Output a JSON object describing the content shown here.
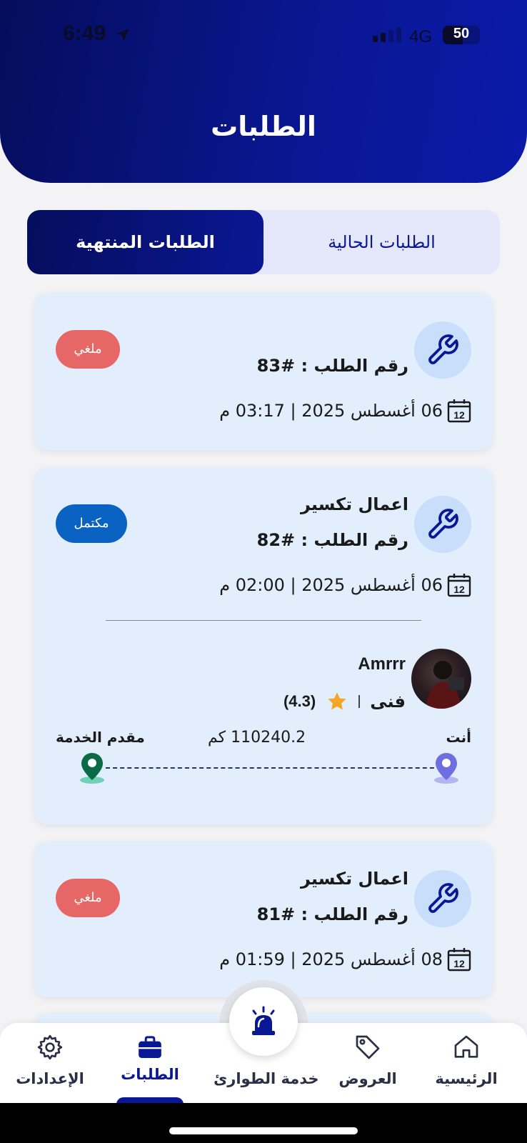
{
  "status_bar": {
    "time": "6:49",
    "network": "4G",
    "battery": "50"
  },
  "header": {
    "title": "الطلبات"
  },
  "tabs": {
    "current": "الطلبات الحالية",
    "ended": "الطلبات المنتهية",
    "selected": "ended"
  },
  "orders": [
    {
      "order_number": "رقم الطلب : #83",
      "date": "06 أغسطس 2025 | 03:17 م",
      "status": "ملغي",
      "icon": "wrench-icon",
      "calendar_day": "12"
    },
    {
      "service": "اعمال تكسير",
      "order_number": "رقم الطلب : #82",
      "date": "06 أغسطس 2025 | 02:00 م",
      "status": "مكتمل",
      "icon": "wrench-icon",
      "calendar_day": "12",
      "provider": {
        "name": "Amrrr",
        "role": "فنى",
        "rating": "(4.3)"
      },
      "trip": {
        "you_label": "أنت",
        "distance": "110240.2 كم",
        "provider_label": "مقدم الخدمة"
      }
    },
    {
      "service": "اعمال تكسير",
      "order_number": "رقم الطلب : #81",
      "date": "08 أغسطس 2025 | 01:59 م",
      "status": "ملغي",
      "icon": "wrench-icon",
      "calendar_day": "12"
    }
  ],
  "bottom_nav": {
    "home": "الرئيسية",
    "offers": "العروض",
    "emergency": "خدمة الطوارئ",
    "orders": "الطلبات",
    "settings": "الإعدادات",
    "active": "orders"
  },
  "colors": {
    "primary": "#0a1794",
    "primary_dark": "#050d5c",
    "card_bg": "#e3eefc",
    "cancel": "#e76766",
    "done": "#0a63c2",
    "star": "#f5a623"
  }
}
